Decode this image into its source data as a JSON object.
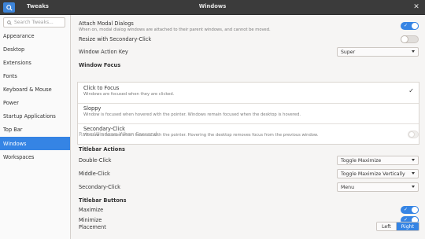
{
  "header": {
    "app_name": "Tweaks",
    "window_title": "Windows"
  },
  "sidebar": {
    "search_placeholder": "Search Tweaks...",
    "items": [
      {
        "label": "Appearance"
      },
      {
        "label": "Desktop"
      },
      {
        "label": "Extensions"
      },
      {
        "label": "Fonts"
      },
      {
        "label": "Keyboard & Mouse"
      },
      {
        "label": "Power"
      },
      {
        "label": "Startup Applications"
      },
      {
        "label": "Top Bar"
      },
      {
        "label": "Windows"
      },
      {
        "label": "Workspaces"
      }
    ],
    "active": "Windows"
  },
  "main": {
    "attach_modal": {
      "label": "Attach Modal Dialogs",
      "desc": "When on, modal dialog windows are attached to their parent windows, and cannot be moved.",
      "on": true
    },
    "resize_secondary": {
      "label": "Resize with Secondary-Click",
      "on": false
    },
    "action_key": {
      "label": "Window Action Key",
      "value": "Super"
    },
    "window_focus": {
      "heading": "Window Focus",
      "options": [
        {
          "label": "Click to Focus",
          "desc": "Windows are focused when they are clicked.",
          "selected": true
        },
        {
          "label": "Sloppy",
          "desc": "Window is focused when hovered with the pointer. Windows remain focused when the desktop is hovered."
        },
        {
          "label": "Secondary-Click",
          "desc": "Window is focused when hovered with the pointer. Hovering the desktop removes focus from the previous window."
        }
      ]
    },
    "raise_windows": {
      "label": "Raise Windows When Focused",
      "on": false
    },
    "titlebar_actions": {
      "heading": "Titlebar Actions",
      "double_click": {
        "label": "Double-Click",
        "value": "Toggle Maximize"
      },
      "middle_click": {
        "label": "Middle-Click",
        "value": "Toggle Maximize Vertically"
      },
      "secondary_click": {
        "label": "Secondary-Click",
        "value": "Menu"
      }
    },
    "titlebar_buttons": {
      "heading": "Titlebar Buttons",
      "maximize": {
        "label": "Maximize",
        "on": true
      },
      "minimize": {
        "label": "Minimize",
        "on": true
      },
      "placement": {
        "label": "Placement",
        "left": "Left",
        "right": "Right",
        "selected": "Right"
      }
    }
  },
  "colors": {
    "accent": "#3584e4",
    "headerbar": "#3b3b3b",
    "sidebar_bg": "#fafafa"
  }
}
